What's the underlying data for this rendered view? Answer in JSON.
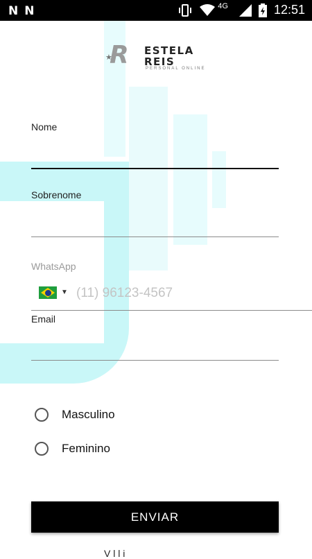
{
  "status_bar": {
    "left_icons": [
      "N",
      "N"
    ],
    "network": "4G",
    "time": "12:51"
  },
  "logo": {
    "line1": "ESTELA",
    "line2": "REIS",
    "tagline": "PERSONAL ONLINE",
    "monogram": "R"
  },
  "form": {
    "nome_label": "Nome",
    "nome_value": "",
    "sobrenome_label": "Sobrenome",
    "sobrenome_value": "",
    "whatsapp_label": "WhatsApp",
    "whatsapp_placeholder": "(11) 96123-4567",
    "country": "Brazil",
    "email_label": "Email",
    "email_value": ""
  },
  "gender": {
    "options": [
      "Masculino",
      "Feminino"
    ],
    "selected": null
  },
  "submit_label": "ENVIAR",
  "footer_partial": "V  l            l  i"
}
